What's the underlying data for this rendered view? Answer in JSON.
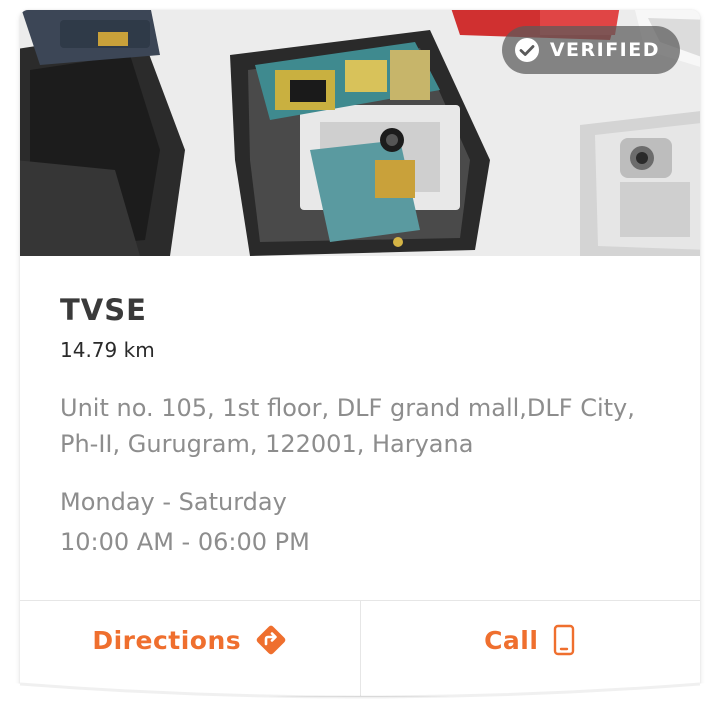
{
  "store": {
    "badge": {
      "label": "VERIFIED",
      "icon": "check-circle-icon"
    },
    "name": "TVSE",
    "distance": "14.79 km",
    "address": "Unit no. 105, 1st floor, DLF grand mall,DLF City, Ph-II, Gurugram, 122001, Haryana",
    "days": "Monday - Saturday",
    "time": "10:00 AM - 06:00 PM"
  },
  "actions": {
    "directions": {
      "label": "Directions",
      "icon": "directions-icon"
    },
    "call": {
      "label": "Call",
      "icon": "mobile-phone-icon"
    }
  },
  "colors": {
    "accent": "#ef6f2e",
    "badge_bg": "#5a5a5a",
    "secondary_text": "#8d8d8d",
    "title_text": "#3a3a3a"
  }
}
